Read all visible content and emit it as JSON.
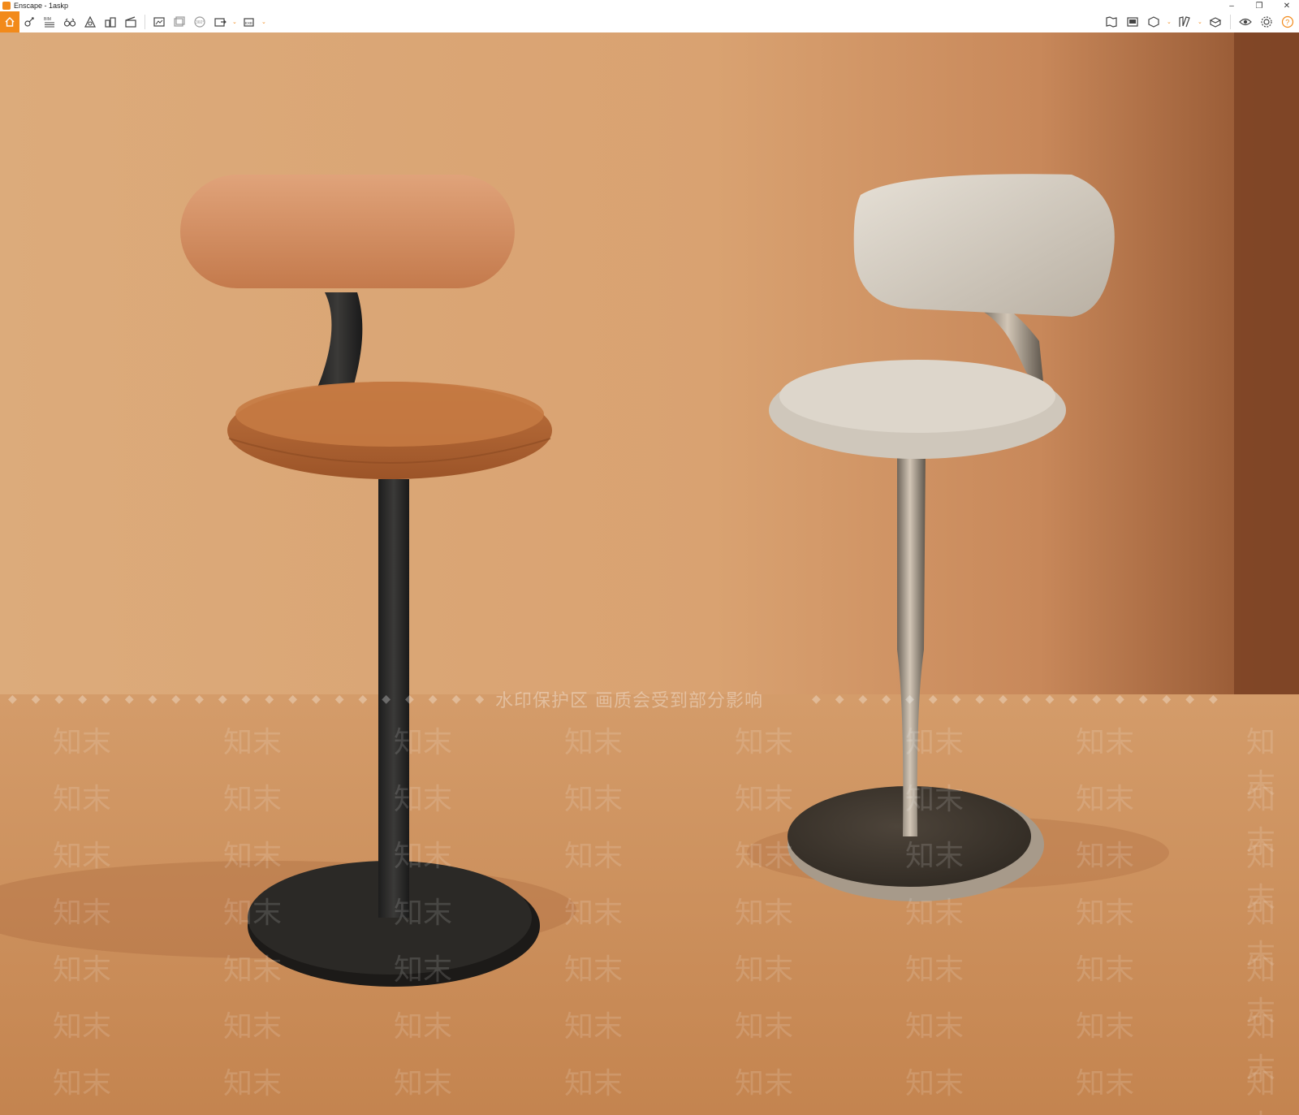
{
  "window": {
    "title": "Enscape - 1askp"
  },
  "toolbar": {
    "left_tools": [
      "home-icon",
      "sync-icon",
      "bim-icon",
      "binoculars-icon",
      "atmosphere-icon",
      "buildings-icon",
      "clapper-icon",
      "screenshot-icon",
      "batch-render-icon",
      "panorama-icon",
      "export-icon",
      "exe-export-icon"
    ],
    "right_tools": [
      "map-icon",
      "view-manager-icon",
      "materials-icon",
      "asset-library-icon",
      "material-editor-icon",
      "visual-settings-icon",
      "settings-icon",
      "help-icon"
    ],
    "bim_label": "BIM",
    "pano_label": "360°",
    "exe_label": "EXE"
  },
  "watermark": {
    "banner": "水印保护区  画质会受到部分影响",
    "tile": "知末"
  },
  "colors": {
    "accent": "#f28a1a",
    "wall": "#dba777",
    "floor": "#c9895a",
    "leather": "#c4773f",
    "boucle": "#d9d3c8",
    "metal_dark": "#2a2a2a",
    "metal_bronze": "#8d8275"
  }
}
